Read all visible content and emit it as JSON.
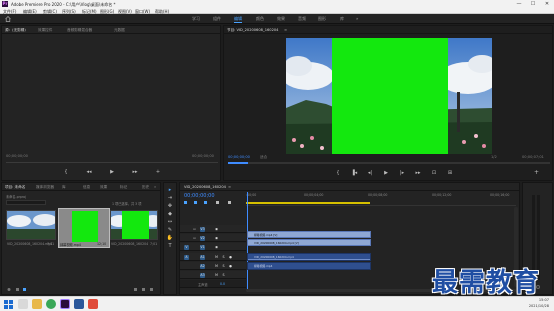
{
  "window": {
    "title": "Adobe Premiere Pro 2020 - C:\\用户\\Vlog\\桌面\\未命名 *",
    "app_icon": "Pr",
    "controls": [
      "—",
      "☐",
      "✕"
    ]
  },
  "menu": [
    "文件(F)",
    "编辑(E)",
    "剪辑(C)",
    "序列(S)",
    "标记(M)",
    "图形(G)",
    "视图(V)",
    "窗口(W)",
    "帮助(H)"
  ],
  "workspaces": {
    "home_icon": "home-icon",
    "items": [
      "学习",
      "组件",
      "编辑",
      "颜色",
      "效果",
      "音频",
      "图形",
      "库"
    ],
    "active": "编辑",
    "more": "»"
  },
  "source_panel": {
    "tabs": [
      "源：(无剪辑)",
      "效果控件",
      "音频剪辑混合器",
      "元数据"
    ],
    "menu": "≡",
    "timecode_left": "00;00;00;00",
    "timecode_right": "00;00;00;00"
  },
  "program_panel": {
    "tab": "节目: VID_20200608_160204",
    "menu": "≡",
    "timecode": "00;00;00;00",
    "fit": "适合",
    "quality": "1/2",
    "duration": "00;00;07;01",
    "colors": {
      "green_screen": "#13e80e"
    }
  },
  "transport": [
    "{",
    "▐◂",
    "◂◂",
    "◂|",
    "▶",
    "|▸",
    "▸▸",
    "+",
    "⊡",
    "⊞"
  ],
  "project_panel": {
    "tabs": [
      "项目: 未命名",
      "媒体浏览器",
      "库",
      "信息",
      "效果",
      "标记",
      "历史"
    ],
    "more": "»",
    "file": "未命名.prproj",
    "item_count": "1 项已选择，共 3 项",
    "items": [
      {
        "name": "VID_20200608_160204.mp4",
        "duration": "7;01"
      },
      {
        "name": "绿幕视频.mp4",
        "duration": "12;10"
      },
      {
        "name": "VID_20200608_160204",
        "duration": "7;01"
      }
    ]
  },
  "tools": [
    "▸",
    "⇥",
    "✥",
    "◆",
    "↔",
    "✎",
    "✋",
    "T"
  ],
  "timeline": {
    "tab": "VID_20200608_160204",
    "menu": "≡",
    "timecode": "00;00;00;00",
    "ruler": [
      ":00;00",
      "00;00;04;00",
      "00;00;08;00",
      "00;00;12;00",
      "00;00;16;00"
    ],
    "tracks": [
      {
        "name": "V3"
      },
      {
        "name": "V2"
      },
      {
        "name": "V1"
      },
      {
        "name": "A1"
      },
      {
        "name": "A2"
      },
      {
        "name": "A3"
      }
    ],
    "master": "主声道",
    "master_value": "0.0",
    "clips": {
      "v2": "绿幕视频.mp4 [V]",
      "v1": "VID_20200608_160204.mp4 [V]",
      "a1": "VID_20200608_160204.mp4",
      "a2": "绿幕视频.mp4"
    }
  },
  "taskbar": {
    "time": "15:07",
    "date": "2021/10/28"
  },
  "watermark": "最需教育"
}
